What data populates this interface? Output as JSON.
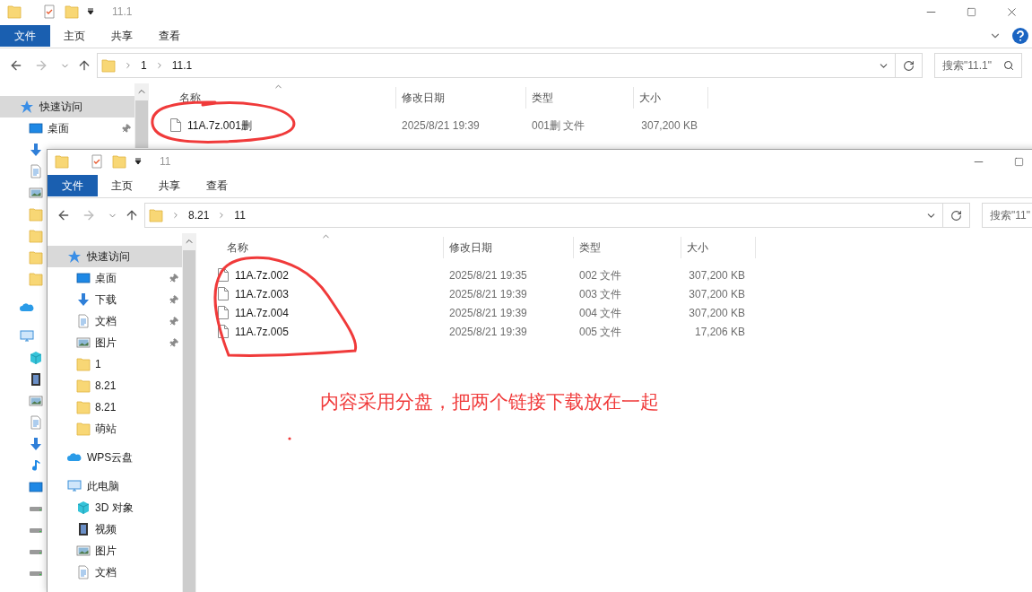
{
  "back_window": {
    "title": "11.1",
    "window_controls": [
      {
        "kind": "minimize"
      },
      {
        "kind": "maximize"
      },
      {
        "kind": "close"
      }
    ],
    "ribbon_tabs": [
      {
        "label": "文件",
        "kind": "file"
      },
      {
        "label": "主页",
        "kind": "tab"
      },
      {
        "label": "共享",
        "kind": "tab"
      },
      {
        "label": "查看",
        "kind": "tab"
      }
    ],
    "ribbon_buttons": [
      {
        "kind": "expand"
      },
      {
        "kind": "help"
      }
    ],
    "path": [
      "1",
      "11.1"
    ],
    "search": {
      "placeholder": "搜索\"11.1\""
    },
    "nav": [
      {
        "label": "快速访问",
        "kind": "quick",
        "selected": true,
        "pinned": false,
        "children": [
          {
            "label": "桌面",
            "kind": "desktop",
            "selected": false,
            "pinned": true
          },
          {
            "kind": "downloads",
            "selected": false
          },
          {
            "kind": "documents",
            "selected": false
          },
          {
            "kind": "pictures",
            "selected": false
          },
          {
            "kind": "folder",
            "selected": false
          },
          {
            "kind": "folder",
            "selected": false
          },
          {
            "kind": "folder",
            "selected": false
          },
          {
            "kind": "folder",
            "selected": false
          }
        ]
      },
      {
        "kind": "cloud",
        "selected": false
      },
      {
        "kind": "pc",
        "selected": false,
        "children": [
          {
            "kind": "objects3d",
            "selected": false
          },
          {
            "kind": "videos",
            "selected": false
          },
          {
            "kind": "pictures",
            "selected": false
          },
          {
            "kind": "documents",
            "selected": false
          },
          {
            "kind": "downloads",
            "selected": false
          },
          {
            "kind": "music",
            "selected": false
          },
          {
            "kind": "desktop",
            "selected": false
          },
          {
            "kind": "drive",
            "selected": false
          },
          {
            "kind": "drive",
            "selected": false
          },
          {
            "kind": "drive",
            "selected": false
          },
          {
            "kind": "drive",
            "selected": false
          }
        ]
      }
    ],
    "columns": [
      "名称",
      "修改日期",
      "类型",
      "大小"
    ],
    "files": [
      {
        "name": "11A.7z.001删",
        "modified": "2025/8/21 19:39",
        "type": "001删 文件",
        "size": "307,200 KB"
      }
    ]
  },
  "front_window": {
    "title": "11",
    "window_controls": [
      {
        "kind": "minimize"
      },
      {
        "kind": "maximize"
      }
    ],
    "ribbon_tabs": [
      {
        "label": "文件",
        "kind": "file"
      },
      {
        "label": "主页",
        "kind": "tab"
      },
      {
        "label": "共享",
        "kind": "tab"
      },
      {
        "label": "查看",
        "kind": "tab"
      }
    ],
    "path": [
      "8.21",
      "11"
    ],
    "search": {
      "placeholder": "搜索\"11\""
    },
    "nav": [
      {
        "label": "快速访问",
        "kind": "quick",
        "selected": true,
        "pinned": false,
        "children": [
          {
            "label": "桌面",
            "kind": "desktop",
            "selected": false,
            "pinned": true
          },
          {
            "label": "下载",
            "kind": "downloads",
            "selected": false,
            "pinned": true
          },
          {
            "label": "文档",
            "kind": "documents",
            "selected": false,
            "pinned": true
          },
          {
            "label": "图片",
            "kind": "pictures",
            "selected": false,
            "pinned": true
          },
          {
            "label": "1",
            "kind": "folder",
            "selected": false,
            "pinned": false
          },
          {
            "label": "8.21",
            "kind": "folder",
            "selected": false,
            "pinned": false
          },
          {
            "label": "8.21",
            "kind": "folder",
            "selected": false,
            "pinned": false
          },
          {
            "label": "萌站",
            "kind": "folder",
            "selected": false,
            "pinned": false
          }
        ]
      },
      {
        "label": "WPS云盘",
        "kind": "cloud",
        "selected": false,
        "pinned": false
      },
      {
        "label": "此电脑",
        "kind": "pc",
        "selected": false,
        "pinned": false,
        "children": [
          {
            "label": "3D 对象",
            "kind": "objects3d",
            "selected": false,
            "pinned": false
          },
          {
            "label": "视频",
            "kind": "videos",
            "selected": false,
            "pinned": false
          },
          {
            "label": "图片",
            "kind": "pictures",
            "selected": false,
            "pinned": false
          },
          {
            "label": "文档",
            "kind": "documents",
            "selected": false,
            "pinned": false
          }
        ]
      }
    ],
    "columns": [
      "名称",
      "修改日期",
      "类型",
      "大小"
    ],
    "files": [
      {
        "name": "11A.7z.002",
        "modified": "2025/8/21 19:35",
        "type": "002 文件",
        "size": "307,200 KB"
      },
      {
        "name": "11A.7z.003",
        "modified": "2025/8/21 19:39",
        "type": "003 文件",
        "size": "307,200 KB"
      },
      {
        "name": "11A.7z.004",
        "modified": "2025/8/21 19:39",
        "type": "004 文件",
        "size": "307,200 KB"
      },
      {
        "name": "11A.7z.005",
        "modified": "2025/8/21 19:39",
        "type": "005 文件",
        "size": "17,206 KB"
      }
    ]
  },
  "annotation": {
    "note": "内容采用分盘，把两个链接下载放在一起"
  }
}
